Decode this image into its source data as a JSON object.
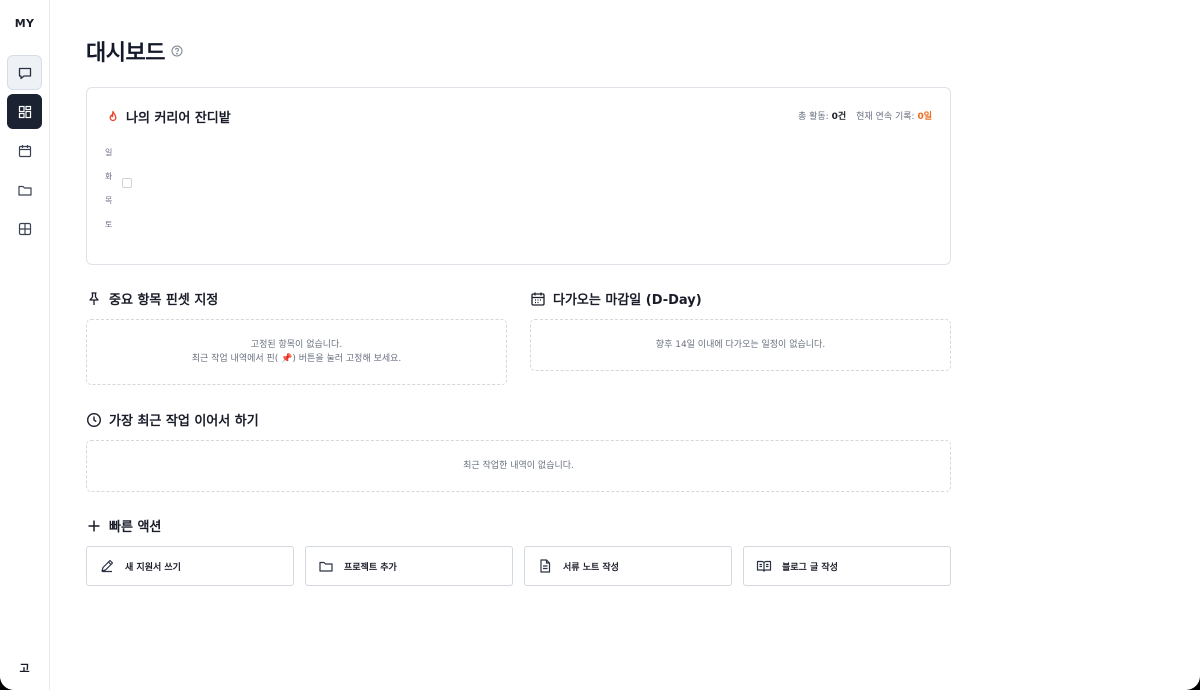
{
  "sidebar": {
    "brand": "MY",
    "items": [
      {
        "name": "chat-icon",
        "state": "selected"
      },
      {
        "name": "dashboard-icon",
        "state": "active"
      },
      {
        "name": "calendar-icon",
        "state": "normal"
      },
      {
        "name": "folder-icon",
        "state": "normal"
      },
      {
        "name": "grid-icon",
        "state": "normal"
      }
    ],
    "bottom_label": "고"
  },
  "page": {
    "title": "대시보드"
  },
  "grass": {
    "title": "나의 커리어 잔디밭",
    "total_label": "총 활동:",
    "total_value": "0건",
    "streak_label": "현재 연속 기록:",
    "streak_value": "0일",
    "days": [
      "일",
      "화",
      "목",
      "토"
    ]
  },
  "pinned": {
    "title": "중요 항목 핀셋 지정",
    "empty_line1": "고정된 항목이 없습니다.",
    "empty_line2": "최근 작업 내역에서 핀( 📌) 버튼을 눌러 고정해 보세요."
  },
  "deadlines": {
    "title": "다가오는 마감일 (D-Day)",
    "empty": "향후 14일 이내에 다가오는 일정이 없습니다."
  },
  "recent": {
    "title": "가장 최근 작업 이어서 하기",
    "empty": "최근 작업한 내역이 없습니다."
  },
  "quick": {
    "title": "빠른 액션",
    "actions": [
      {
        "label": "새 지원서 쓰기",
        "icon": "pen-icon"
      },
      {
        "label": "프로젝트 추가",
        "icon": "folder-icon"
      },
      {
        "label": "서류 노트 작성",
        "icon": "document-icon"
      },
      {
        "label": "블로그 글 작성",
        "icon": "book-icon"
      }
    ]
  },
  "colors": {
    "accent": "#f26b1d",
    "nav_active": "#1b2333"
  }
}
